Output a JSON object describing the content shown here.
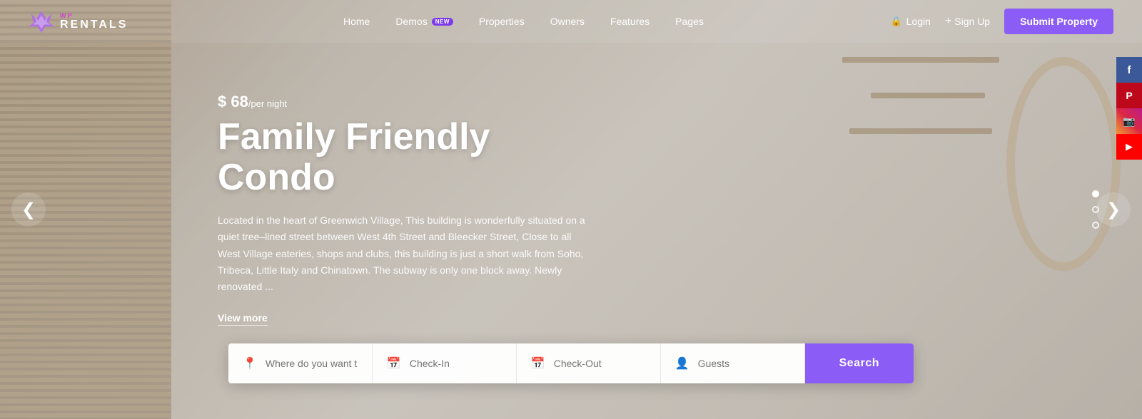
{
  "logo": {
    "top_text": "WP",
    "bottom_text": "RENTALS"
  },
  "nav": {
    "items": [
      {
        "label": "Home",
        "badge": null
      },
      {
        "label": "Demos",
        "badge": "new"
      },
      {
        "label": "Properties",
        "badge": null
      },
      {
        "label": "Owners",
        "badge": null
      },
      {
        "label": "Features",
        "badge": null
      },
      {
        "label": "Pages",
        "badge": null
      }
    ],
    "login_label": "Login",
    "signup_label": "Sign Up",
    "submit_label": "Submit Property"
  },
  "hero": {
    "price_prefix": "$ ",
    "price_amount": "68",
    "price_suffix": "/per night",
    "title": "Family Friendly Condo",
    "description": "Located in the heart of Greenwich Village, This building is wonderfully situated on a quiet tree–lined street between West 4th Street and Bleecker Street, Close to all West Village eateries, shops and clubs, this building is just a short walk from Soho, Tribeca, Little Italy and Chinatown. The subway is only one block away. Newly renovated ...",
    "view_more_label": "View more",
    "dots": [
      {
        "active": true
      },
      {
        "active": false
      },
      {
        "active": false
      }
    ],
    "arrow_left": "❮",
    "arrow_right": "❯"
  },
  "social": [
    {
      "name": "facebook",
      "icon": "f",
      "class": "social-fb"
    },
    {
      "name": "pinterest",
      "icon": "P",
      "class": "social-pin"
    },
    {
      "name": "instagram",
      "icon": "◉",
      "class": "social-ig"
    },
    {
      "name": "youtube",
      "icon": "▶",
      "class": "social-yt"
    }
  ],
  "search": {
    "location_placeholder": "Where do you want to go ?",
    "checkin_placeholder": "Check-In",
    "checkout_placeholder": "Check-Out",
    "guests_placeholder": "Guests",
    "button_label": "Search"
  }
}
